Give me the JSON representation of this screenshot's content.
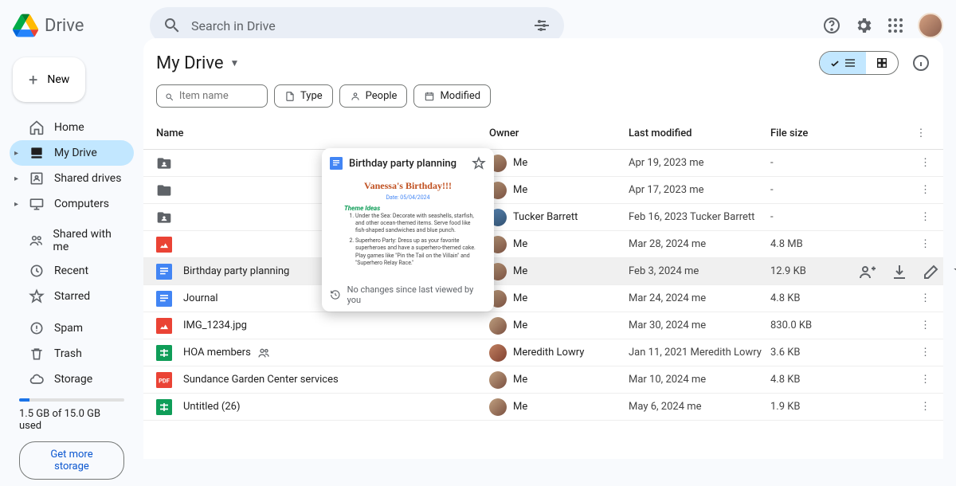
{
  "app": {
    "name": "Drive",
    "search_placeholder": "Search in Drive"
  },
  "sidebar": {
    "new_label": "New",
    "items": [
      {
        "label": "Home"
      },
      {
        "label": "My Drive"
      },
      {
        "label": "Shared drives"
      },
      {
        "label": "Computers"
      },
      {
        "label": "Shared with me"
      },
      {
        "label": "Recent"
      },
      {
        "label": "Starred"
      },
      {
        "label": "Spam"
      },
      {
        "label": "Trash"
      },
      {
        "label": "Storage"
      }
    ],
    "storage_text": "1.5 GB of 15.0 GB used",
    "storage_cta": "Get more storage"
  },
  "main": {
    "title": "My Drive",
    "filters": {
      "search_placeholder": "Item name",
      "type": "Type",
      "people": "People",
      "modified": "Modified"
    },
    "columns": {
      "name": "Name",
      "owner": "Owner",
      "modified": "Last modified",
      "size": "File size"
    },
    "rows": [
      {
        "name": "",
        "owner": "Me",
        "modified": "Apr 19, 2023 me",
        "size": "-",
        "ft": "folder-person",
        "oav": ""
      },
      {
        "name": "",
        "owner": "Me",
        "modified": "Apr 17, 2023 me",
        "size": "-",
        "ft": "folder",
        "oav": ""
      },
      {
        "name": "",
        "owner": "Tucker Barrett",
        "modified": "Feb 16, 2023 Tucker Barrett",
        "size": "-",
        "ft": "folder-person",
        "oav": "alt1"
      },
      {
        "name": "",
        "owner": "Me",
        "modified": "Mar 28, 2024 me",
        "size": "4.8 MB",
        "ft": "image",
        "oav": ""
      },
      {
        "name": "Birthday party planning",
        "owner": "Me",
        "modified": "Feb 3, 2024 me",
        "size": "12.9 KB",
        "ft": "doc",
        "oav": "",
        "hovered": true
      },
      {
        "name": "Journal",
        "owner": "Me",
        "modified": "Mar 24, 2024 me",
        "size": "4.8 KB",
        "ft": "doc",
        "oav": ""
      },
      {
        "name": "IMG_1234.jpg",
        "owner": "Me",
        "modified": "Mar 30, 2024 me",
        "size": "830.0 KB",
        "ft": "image",
        "oav": ""
      },
      {
        "name": "HOA members",
        "owner": "Meredith Lowry",
        "modified": "Jan 11, 2021 Meredith Lowry",
        "size": "3.6 KB",
        "ft": "sheet",
        "oav": "alt2",
        "shared": true
      },
      {
        "name": "Sundance Garden Center services",
        "owner": "Me",
        "modified": "Mar 10, 2024 me",
        "size": "4.8 KB",
        "ft": "pdf",
        "oav": ""
      },
      {
        "name": "Untitled (26)",
        "owner": "Me",
        "modified": "May 6, 2024 me",
        "size": "1.9 KB",
        "ft": "sheet",
        "oav": ""
      }
    ]
  },
  "hover_card": {
    "title": "Birthday party planning",
    "preview": {
      "heading": "Vanessa's Birthday!!!",
      "date": "Date: 05/04/2024",
      "theme_label": "Theme Ideas",
      "items": [
        "Under the Sea: Decorate with seashells, starfish, and other ocean-themed items. Serve food like fish-shaped sandwiches and blue punch.",
        "Superhero Party: Dress up as your favorite superheroes and have a superhero-themed cake. Play games like \"Pin the Tail on the Villain\" and \"Superhero Relay Race.\""
      ]
    },
    "footer": "No changes since last viewed by you"
  }
}
